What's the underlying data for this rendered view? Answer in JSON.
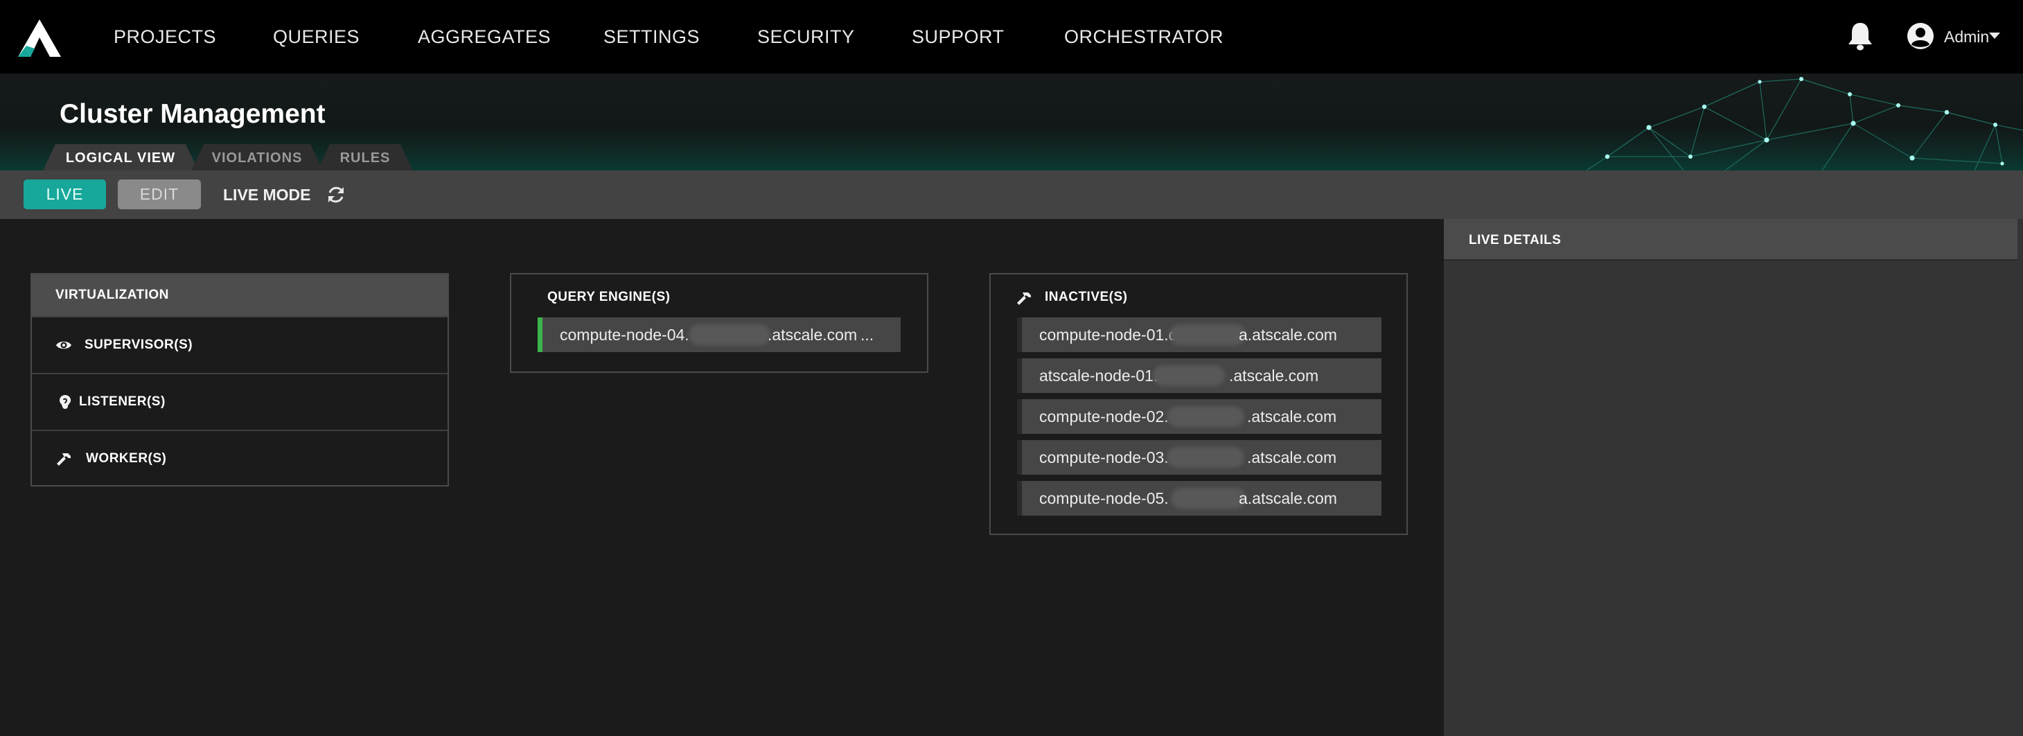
{
  "nav": {
    "items": [
      {
        "key": "projects",
        "label": "PROJECTS"
      },
      {
        "key": "queries",
        "label": "QUERIES"
      },
      {
        "key": "aggregates",
        "label": "AGGREGATES"
      },
      {
        "key": "settings",
        "label": "SETTINGS"
      },
      {
        "key": "security",
        "label": "SECURITY"
      },
      {
        "key": "support",
        "label": "SUPPORT"
      },
      {
        "key": "orchestrator",
        "label": "ORCHESTRATOR"
      }
    ],
    "user": "Admin",
    "icons": {
      "logo": "atscale-logo-icon",
      "bell": "bell-icon",
      "user": "user-circle-icon",
      "caret": "caret-down-icon"
    }
  },
  "page": {
    "title": "Cluster Management",
    "tabs": [
      {
        "label": "LOGICAL VIEW",
        "active": true
      },
      {
        "label": "VIOLATIONS",
        "active": false
      },
      {
        "label": "RULES",
        "active": false
      }
    ]
  },
  "toolbar": {
    "live_label": "LIVE",
    "edit_label": "EDIT",
    "live_mode_label": "LIVE MODE",
    "refresh_icon": "refresh-icon"
  },
  "virtualization": {
    "title": "VIRTUALIZATION",
    "rows": [
      {
        "label": "SUPERVISOR(S)",
        "icon": "eye-icon"
      },
      {
        "label": "LISTENER(S)",
        "icon": "ear-icon"
      },
      {
        "label": "WORKER(S)",
        "icon": "hammer-icon"
      }
    ]
  },
  "query_engines": {
    "title": "QUERY ENGINE(S)",
    "nodes": [
      {
        "prefix": "compute-node-04.",
        "suffix": ".atscale.com",
        "extra": "...",
        "status": "active"
      }
    ]
  },
  "inactive": {
    "title": "INACTIVE(S)",
    "icon": "hammer-icon",
    "nodes": [
      {
        "prefix": "compute-node-01.c",
        "suffix": "a.atscale.com"
      },
      {
        "prefix": "atscale-node-01.",
        "suffix": ".atscale.com"
      },
      {
        "prefix": "compute-node-02.",
        "suffix": ".atscale.com"
      },
      {
        "prefix": "compute-node-03.",
        "suffix": ".atscale.com"
      },
      {
        "prefix": "compute-node-05.",
        "suffix": "a.atscale.com"
      }
    ]
  },
  "live_details": {
    "title": "LIVE DETAILS"
  },
  "colors": {
    "accent": "#18a89b",
    "active_status": "#3cb44b",
    "nav_bg": "#000000",
    "panel_bg": "#343434"
  }
}
